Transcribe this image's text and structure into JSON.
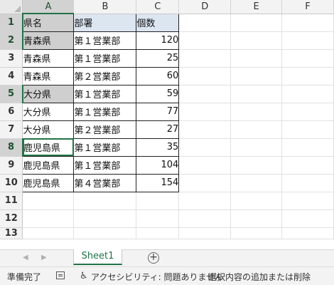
{
  "columns": [
    "A",
    "B",
    "C",
    "D",
    "E",
    "F"
  ],
  "rows": [
    {
      "num": "1",
      "a": "県名",
      "b": "部署",
      "c": "個数"
    },
    {
      "num": "2",
      "a": "青森県",
      "b": "第１営業部",
      "c": "120"
    },
    {
      "num": "3",
      "a": "青森県",
      "b": "第１営業部",
      "c": "25"
    },
    {
      "num": "4",
      "a": "青森県",
      "b": "第２営業部",
      "c": "60"
    },
    {
      "num": "5",
      "a": "大分県",
      "b": "第１営業部",
      "c": "59"
    },
    {
      "num": "6",
      "a": "大分県",
      "b": "第１営業部",
      "c": "77"
    },
    {
      "num": "7",
      "a": "大分県",
      "b": "第２営業部",
      "c": "27"
    },
    {
      "num": "8",
      "a": "鹿児島県",
      "b": "第１営業部",
      "c": "35"
    },
    {
      "num": "9",
      "a": "鹿児島県",
      "b": "第１営業部",
      "c": "104"
    },
    {
      "num": "10",
      "a": "鹿児島県",
      "b": "第４営業部",
      "c": "154"
    },
    {
      "num": "11",
      "a": "",
      "b": "",
      "c": ""
    },
    {
      "num": "12",
      "a": "",
      "b": "",
      "c": ""
    },
    {
      "num": "13",
      "a": "",
      "b": "",
      "c": ""
    }
  ],
  "sheet_tab": "Sheet1",
  "status": {
    "ready": "準備完了",
    "accessibility": "アクセシビリティ: 問題ありません",
    "hint": "選択内容の追加または削除"
  }
}
